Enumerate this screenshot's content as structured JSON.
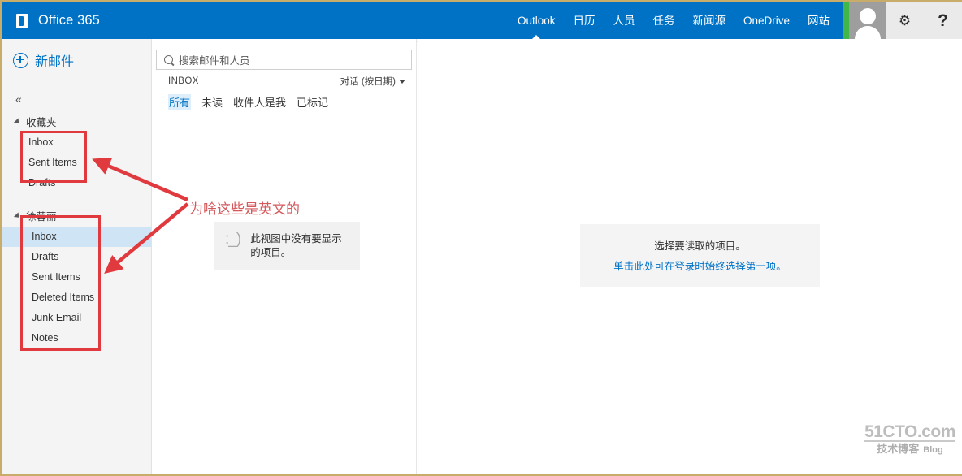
{
  "suite": {
    "brand": "Office 365",
    "brand_icon": "office-logo-icon",
    "nav_items": [
      {
        "label": "Outlook",
        "active": true
      },
      {
        "label": "日历",
        "active": false
      },
      {
        "label": "人员",
        "active": false
      },
      {
        "label": "任务",
        "active": false
      },
      {
        "label": "新闻源",
        "active": false
      },
      {
        "label": "OneDrive",
        "active": false
      },
      {
        "label": "网站",
        "active": false
      }
    ],
    "settings_icon": "gear-icon",
    "settings_glyph": "⚙",
    "help_icon": "question-mark-icon",
    "help_glyph": "?",
    "avatar_icon": "user-avatar-icon"
  },
  "leftnav": {
    "new_mail_label": "新邮件",
    "new_mail_icon": "plus-circle-icon",
    "collapse_glyph": "«",
    "groups": [
      {
        "title": "收藏夹",
        "folders": [
          {
            "label": "Inbox",
            "selected": false
          },
          {
            "label": "Sent Items",
            "selected": false
          },
          {
            "label": "Drafts",
            "selected": false
          }
        ]
      },
      {
        "title": "徐蓉丽",
        "folders": [
          {
            "label": "Inbox",
            "selected": true
          },
          {
            "label": "Drafts",
            "selected": false
          },
          {
            "label": "Sent Items",
            "selected": false
          },
          {
            "label": "Deleted Items",
            "selected": false
          },
          {
            "label": "Junk Email",
            "selected": false
          },
          {
            "label": "Notes",
            "selected": false
          }
        ]
      }
    ]
  },
  "list": {
    "search_placeholder": "搜索邮件和人员",
    "search_value": "",
    "search_icon": "search-icon",
    "folder_label": "INBOX",
    "sort_label": "对话 (按日期)",
    "sort_icon": "chevron-down-icon",
    "filters": [
      {
        "label": "所有",
        "active": true
      },
      {
        "label": "未读",
        "active": false
      },
      {
        "label": "收件人是我",
        "active": false
      },
      {
        "label": "已标记",
        "active": false
      }
    ],
    "empty_face": ":_)",
    "empty_message": "此视图中没有要显示的项目。"
  },
  "reading": {
    "prompt": "选择要读取的项目。",
    "link": "单击此处可在登录时始终选择第一项。"
  },
  "annotation": {
    "note": "为啥这些是英文的",
    "color": "#e03a3e"
  },
  "watermark": {
    "line1": "51CTO.com",
    "line2": "技术博客",
    "line3": "Blog"
  }
}
